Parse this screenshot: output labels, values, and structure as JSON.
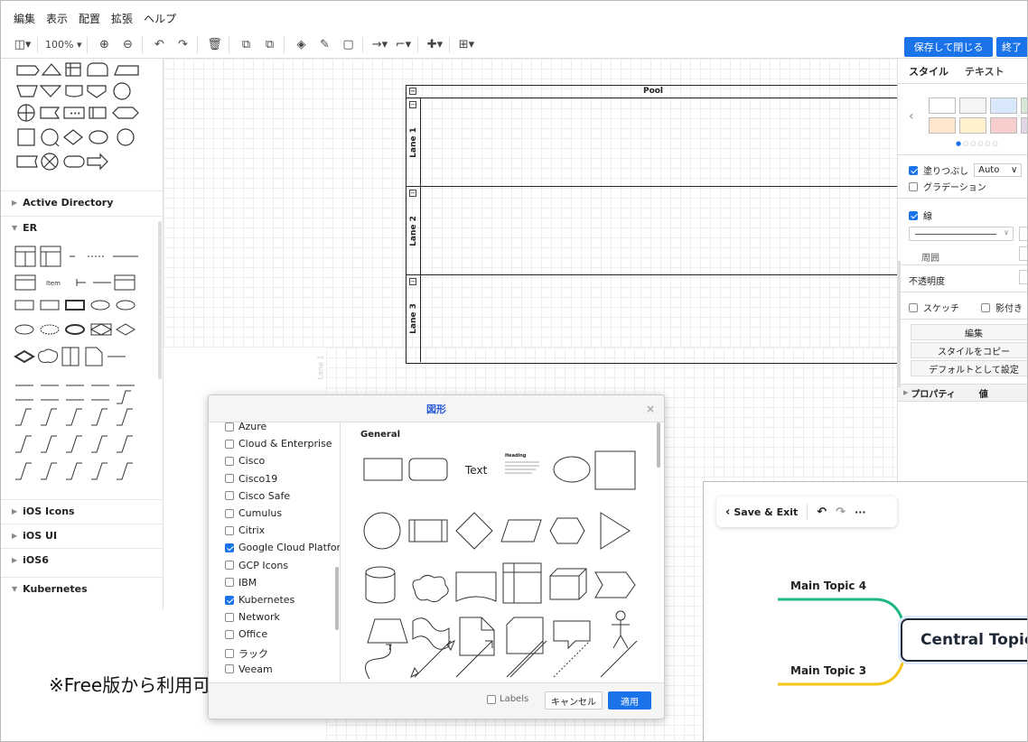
{
  "menu": {
    "items": [
      "編集",
      "表示",
      "配置",
      "拡張",
      "ヘルプ"
    ]
  },
  "toolbar": {
    "zoom": "100%",
    "save_close": "保存して閉じる",
    "exit": "終了"
  },
  "sidebar": {
    "sections": [
      {
        "label": "Active Directory",
        "state": "collapsed"
      },
      {
        "label": "ER",
        "state": "expanded"
      },
      {
        "label": "iOS Icons",
        "state": "collapsed"
      },
      {
        "label": "iOS UI",
        "state": "collapsed"
      },
      {
        "label": "iOS6",
        "state": "collapsed"
      },
      {
        "label": "Kubernetes",
        "state": "expanded"
      }
    ],
    "er_item_label": "Item"
  },
  "canvas": {
    "pool_title": "Pool",
    "lanes": [
      "Lane 1",
      "Lane 2",
      "Lane 3"
    ],
    "ghost_lane": "Lane 1"
  },
  "format_panel": {
    "tabs": [
      "スタイル",
      "テキスト"
    ],
    "fill_label": "塗りつぶし",
    "fill_value": "Auto",
    "gradient_label": "グラデーション",
    "line_label": "線",
    "perimeter_label": "周囲",
    "opacity_label": "不透明度",
    "sketch_label": "スケッチ",
    "shadow_label": "影付き",
    "edit_btn": "編集",
    "copy_style_btn": "スタイルをコピー",
    "default_btn": "デフォルトとして設定",
    "props_label": "プロパティ",
    "value_label": "値",
    "swatch_colors": [
      "#ffffff",
      "#f5f5f5",
      "#dae8fc",
      "#d5e8d4",
      "#ffe6cc",
      "#fff2cc",
      "#f8cecc",
      "#e1d5e7"
    ]
  },
  "dialog": {
    "title": "図形",
    "close": "×",
    "section_title": "General",
    "text_shape": "Text",
    "heading_shape": "Heading",
    "libraries": [
      {
        "label": "Azure",
        "checked": false
      },
      {
        "label": "Cloud & Enterprise",
        "checked": false
      },
      {
        "label": "Cisco",
        "checked": false
      },
      {
        "label": "Cisco19",
        "checked": false
      },
      {
        "label": "Cisco Safe",
        "checked": false
      },
      {
        "label": "Cumulus",
        "checked": false
      },
      {
        "label": "Citrix",
        "checked": false
      },
      {
        "label": "Google Cloud Platform",
        "checked": true
      },
      {
        "label": "GCP Icons",
        "checked": false
      },
      {
        "label": "IBM",
        "checked": false
      },
      {
        "label": "Kubernetes",
        "checked": true
      },
      {
        "label": "Network",
        "checked": false
      },
      {
        "label": "Office",
        "checked": false
      },
      {
        "label": "ラック",
        "checked": false
      },
      {
        "label": "Veeam",
        "checked": false
      }
    ],
    "labels_option": "Labels",
    "cancel": "キャンセル",
    "apply": "適用"
  },
  "note": "※Free版から利用可能",
  "mindmap": {
    "save_exit": "Save & Exit",
    "more": "···",
    "topic_4": "Main Topic 4",
    "topic_3": "Main Topic 3",
    "central": "Central Topic",
    "colors": {
      "branch_top": "#1db981",
      "branch_bottom": "#f5c518",
      "central_border": "#1f2937"
    }
  }
}
